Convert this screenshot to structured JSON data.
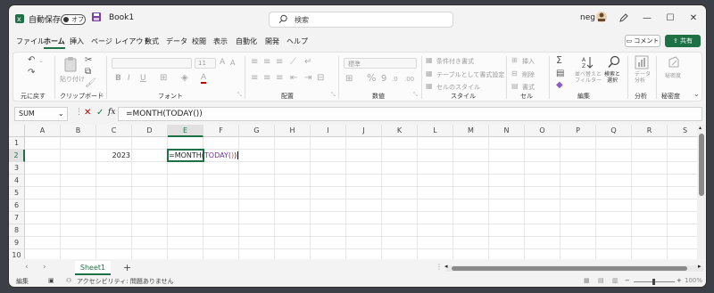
{
  "titlebar": {
    "autosave_label": "自動保存",
    "autosave_state": "オフ",
    "book_name": "Book1",
    "search_placeholder": "検索",
    "user_name": "neg"
  },
  "menu": {
    "items": [
      "ファイル",
      "ホーム",
      "挿入",
      "ページ レイアウト",
      "数式",
      "データ",
      "校閲",
      "表示",
      "自動化",
      "開発",
      "ヘルプ"
    ],
    "active_index": 1,
    "comment_label": "コメント",
    "share_label": "共有"
  },
  "ribbon": {
    "groups": {
      "undo": "元に戻す",
      "clipboard": "クリップボード",
      "font": "フォント",
      "alignment": "配置",
      "number": "数値",
      "styles": "スタイル",
      "cells": "セル",
      "editing": "編集",
      "analysis": "分析",
      "sensitivity": "秘密度"
    },
    "paste_label": "貼り付け",
    "font_size": "11",
    "number_format": "標準",
    "conditional_format": "条件付き書式",
    "format_as_table": "テーブルとして書式設定",
    "cell_styles": "セルのスタイル",
    "insert": "挿入",
    "delete": "削除",
    "format": "書式",
    "sort_filter": "並べ替えと\nフィルター",
    "find_select": "検索と\n選択",
    "analyze_data": "データ\n分析",
    "sensitivity_btn": "秘密度",
    "bold": "B",
    "italic": "I",
    "underline": "U",
    "font_color": "A",
    "fill_color": "A",
    "percent": "%",
    "sum": "Σ"
  },
  "formula_bar": {
    "name_box": "SUM",
    "fx": "fx",
    "formula": "=MONTH(TODAY())"
  },
  "grid": {
    "columns": [
      "A",
      "B",
      "C",
      "D",
      "E",
      "F",
      "G",
      "H",
      "I",
      "J",
      "K",
      "L",
      "M",
      "N",
      "O",
      "P",
      "Q",
      "R",
      "S"
    ],
    "rows": [
      "1",
      "2",
      "3",
      "4",
      "5",
      "6",
      "7",
      "8",
      "9",
      "10"
    ],
    "selected_column": "E",
    "selected_row": "2",
    "cell_C2": "2023",
    "edit_prefix": "=MONTH(",
    "edit_today": "TODAY(",
    "edit_paren": ")",
    "edit_suffix": ")"
  },
  "sheets": {
    "tabs": [
      "Sheet1"
    ],
    "add": "+"
  },
  "status": {
    "mode": "編集",
    "accessibility": "アクセシビリティ: 問題ありません",
    "zoom": "100%"
  },
  "colors": {
    "accent": "#1e7145",
    "today_fn": "#7030a0",
    "paren": "#c0504d"
  }
}
